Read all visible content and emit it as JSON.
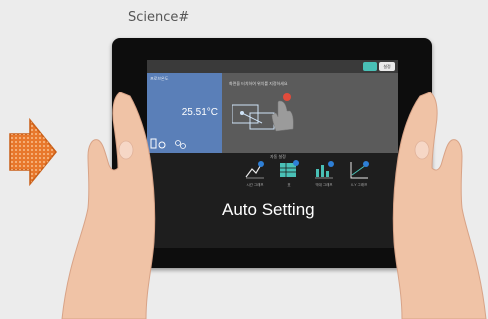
{
  "brand": "Science#",
  "screen": {
    "temperature_panel_label": "프로브온도",
    "temperature_value": "25.51°C",
    "instruction_text": "화면을 터치하여 위치를 지정하세요",
    "tools_title": "자동 설정",
    "tool_labels": [
      "시간 그래프",
      "표",
      "막대 그래프",
      "X-Y 그래프"
    ],
    "topbar_right_label": "설정"
  },
  "caption": "Auto Setting",
  "colors": {
    "accent_teal": "#49c0b6",
    "temp_panel_blue": "#5a7fb8",
    "badge_orange": "#e8782c"
  }
}
